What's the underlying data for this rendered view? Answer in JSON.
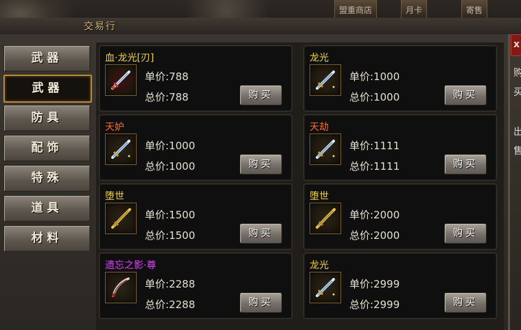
{
  "top_tabs": [
    "盟重商店",
    "月卡",
    "寄售"
  ],
  "window": {
    "title": "交易行",
    "close": "x"
  },
  "right_panel": [
    "购",
    "买",
    "出",
    "售"
  ],
  "categories": [
    {
      "label": "武器",
      "active": false
    },
    {
      "label": "武器",
      "active": true
    },
    {
      "label": "防具",
      "active": false
    },
    {
      "label": "配饰",
      "active": false
    },
    {
      "label": "特殊",
      "active": false
    },
    {
      "label": "道具",
      "active": false
    },
    {
      "label": "材料",
      "active": false
    }
  ],
  "price_prefix": {
    "unit": "单价:",
    "total": "总价:"
  },
  "buy_label": "购买",
  "items": [
    {
      "name": "血·龙光[刃]",
      "name_color": "#f2d34a",
      "unit_price": "788",
      "total_price": "788",
      "icon": "sword-icon-red"
    },
    {
      "name": "龙光",
      "name_color": "#f2d34a",
      "unit_price": "1000",
      "total_price": "1000",
      "icon": "sword-icon"
    },
    {
      "name": "天妒",
      "name_color": "#ff6a2a",
      "unit_price": "1000",
      "total_price": "1000",
      "icon": "sword-icon"
    },
    {
      "name": "天劫",
      "name_color": "#ff6a2a",
      "unit_price": "1111",
      "total_price": "1111",
      "icon": "sword-icon"
    },
    {
      "name": "堕世",
      "name_color": "#f2d34a",
      "unit_price": "1500",
      "total_price": "1500",
      "icon": "golden-blade-icon"
    },
    {
      "name": "堕世",
      "name_color": "#f2d34a",
      "unit_price": "2000",
      "total_price": "2000",
      "icon": "golden-blade-icon"
    },
    {
      "name": "遗忘之影·尊",
      "name_color": "#e040ff",
      "unit_price": "2288",
      "total_price": "2288",
      "icon": "curved-blade-icon"
    },
    {
      "name": "龙光",
      "name_color": "#f2d34a",
      "unit_price": "2999",
      "total_price": "2999",
      "icon": "sword-icon"
    }
  ]
}
